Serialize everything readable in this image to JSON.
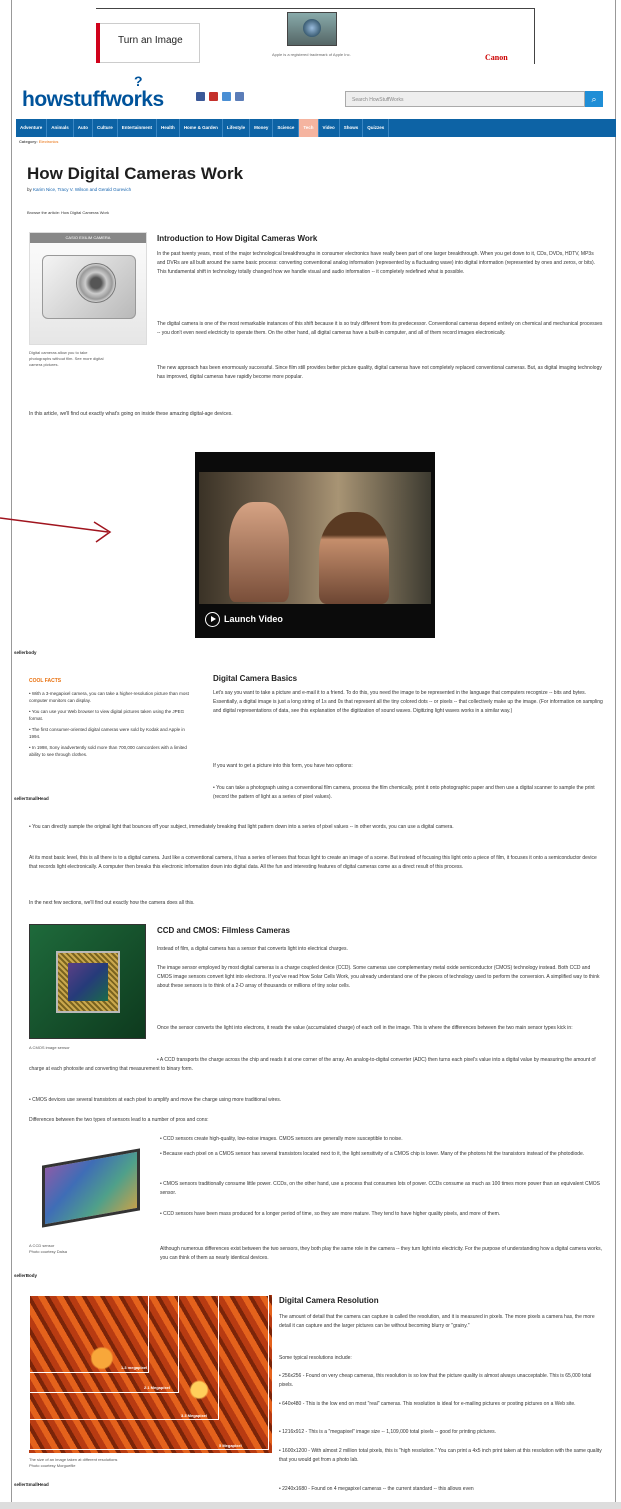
{
  "ad": {
    "headline": "Turn an Image",
    "fine_print": "Apple is a registered trademark of Apple Inc.",
    "brand": "Canon"
  },
  "header": {
    "logo": "howstuffworks",
    "search_placeholder": "Search HowStuffWorks"
  },
  "nav": {
    "items": [
      "Adventure",
      "Animals",
      "Auto",
      "Culture",
      "Entertainment",
      "Health",
      "Home & Garden",
      "Lifestyle",
      "Money",
      "Science",
      "Tech",
      "Video",
      "Shows",
      "Quizzes"
    ],
    "active_index": 10
  },
  "breadcrumb": {
    "prefix": "Category:",
    "current": "Electronics"
  },
  "article": {
    "title": "How Digital Cameras Work",
    "byline_prefix": "by",
    "authors": "Karim Nice, Tracy V. Wilson and Gerald Gurevich",
    "browse": "Browse the article: How Digital Cameras Work",
    "image_caption_top": "CASIO EXILIM CAMERA",
    "image_caption": "Digital cameras allow you to take photographs without film. See more digital camera pictures.",
    "intro_heading": "Introduction to How Digital Cameras Work",
    "intro_p1": "In the past twenty years, most of the major technological breakthroughs in consumer electronics have really been part of one larger breakthrough. When you get down to it, CDs, DVDs, HDTV, MP3s and DVRs are all built around the same basic process: converting conventional analog information (represented by a fluctuating wave) into digital information (represented by ones and zeros, or bits). This fundamental shift in technology totally changed how we handle visual and audio information -- it completely redefined what is possible.",
    "intro_p2": "The digital camera is one of the most remarkable instances of this shift because it is so truly different from its predecessor. Conventional cameras depend entirely on chemical and mechanical processes -- you don't even need electricity to operate them. On the other hand, all digital cameras have a built-in computer, and all of them record images electronically.",
    "intro_p3": "The new approach has been enormously successful. Since film still provides better picture quality, digital cameras have not completely replaced conventional cameras. But, as digital imaging technology has improved, digital cameras have rapidly become more popular.",
    "intro_p4": "In this article, we'll find out exactly what's going on inside these amazing digital-age devices.",
    "video_label": "Launch Video",
    "label_sellerbody1": "sellerbody",
    "facts_title": "COOL FACTS",
    "facts": [
      "With a 3-megapixel camera, you can take a higher-resolution picture than most computer monitors can display.",
      "You can use your Web browser to view digital pictures taken using the JPEG format.",
      "The first consumer-oriented digital cameras were sold by Kodak and Apple in 1994.",
      "In 1998, Sony inadvertently sold more than 700,000 camcorders with a limited ability to see through clothes."
    ],
    "label_sellersmall1": "sellerSmallHead",
    "basics_heading": "Digital Camera Basics",
    "basics_p1": "Let's say you want to take a picture and e-mail it to a friend. To do this, you need the image to be represented in the language that computers recognize -- bits and bytes. Essentially, a digital image is just a long string of 1s and 0s that represent all the tiny colored dots -- or pixels -- that collectively make up the image. (For information on sampling and digital representations of data, see this explanation of the digitization of sound waves. Digitizing light waves works in a similar way.)",
    "basics_p2": "If you want to get a picture into this form, you have two options:",
    "basics_opt1": "You can take a photograph using a conventional film camera, process the film chemically, print it onto photographic paper and then use a digital scanner to sample the print (record the pattern of light as a series of pixel values).",
    "basics_opt2": "You can directly sample the original light that bounces off your subject, immediately breaking that light pattern down into a series of pixel values -- in other words, you can use a digital camera.",
    "basics_p3": "At its most basic level, this is all there is to a digital camera. Just like a conventional camera, it has a series of lenses that focus light to create an image of a scene. But instead of focusing this light onto a piece of film, it focuses it onto a semiconductor device that records light electronically. A computer then breaks this electronic information down into digital data. All the fun and interesting features of digital cameras come as a direct result of this process.",
    "basics_p4": "In the next few sections, we'll find out exactly how the camera does all this.",
    "ccd_heading": "CCD and CMOS: Filmless Cameras",
    "ccd_p1": "Instead of film, a digital camera has a sensor that converts light into electrical charges.",
    "ccd_p2": "The image sensor employed by most digital cameras is a charge coupled device (CCD). Some cameras use complementary metal oxide semiconductor (CMOS) technology instead. Both CCD and CMOS image sensors convert light into electrons. If you've read How Solar Cells Work, you already understand one of the pieces of technology used to perform the conversion. A simplified way to think about these sensors is to think of a 2-D array of thousands or millions of tiny solar cells.",
    "ccd_p3": "Once the sensor converts the light into electrons, it reads the value (accumulated charge) of each cell in the image. This is where the differences between the two main sensor types kick in:",
    "ccd_b1": "A CCD transports the charge across the chip and reads it at one corner of the array. An analog-to-digital converter (ADC) then turns each pixel's value into a digital value by measuring the amount of charge at each photosite and converting that measurement to binary form.",
    "ccd_b2": "CMOS devices use several transistors at each pixel to amplify and move the charge using more traditional wires.",
    "chip_caption": "A CMOS image sensor",
    "diff_intro": "Differences between the two types of sensors lead to a number of pros and cons:",
    "diffs": [
      "CCD sensors create high-quality, low-noise images. CMOS sensors are generally more susceptible to noise.",
      "Because each pixel on a CMOS sensor has several transistors located next to it, the light sensitivity of a CMOS chip is lower. Many of the photons hit the transistors instead of the photodiode.",
      "CMOS sensors traditionally consume little power. CCDs, on the other hand, use a process that consumes lots of power. CCDs consume as much as 100 times more power than an equivalent CMOS sensor.",
      "CCD sensors have been mass produced for a longer period of time, so they are more mature. They tend to have higher quality pixels, and more of them."
    ],
    "diff_outro": "Although numerous differences exist between the two sensors, they both play the same role in the camera -- they turn light into electricity. For the purpose of understanding how a digital camera works, you can think of them as nearly identical devices.",
    "sensor_caption": "A CCD sensor\nPhoto courtesy Dalsa",
    "label_sellerbody2": "sellerBody",
    "res_heading": "Digital Camera Resolution",
    "res_p1": "The amount of detail that the camera can capture is called the resolution, and it is measured in pixels. The more pixels a camera has, the more detail it can capture and the larger pictures can be without becoming blurry or \"grainy.\"",
    "res_p2": "Some typical resolutions include:",
    "res_items": [
      "256x256 - Found on very cheap cameras, this resolution is so low that the picture quality is almost always unacceptable. This is 65,000 total pixels.",
      "640x480 - This is the low end on most \"real\" cameras. This resolution is ideal for e-mailing pictures or posting pictures on a Web site.",
      "1216x912 - This is a \"megapixel\" image size -- 1,109,000 total pixels -- good for printing pictures.",
      "1600x1200 - With almost 2 million total pixels, this is \"high resolution.\" You can print a 4x5 inch print taken at this resolution with the same quality that you would get from a photo lab.",
      "2240x1680 - Found on 4 megapixel cameras -- the current standard -- this allows even"
    ],
    "res_labels": [
      "1.3 megapixel",
      "2.1 Megapixel",
      "3.3 Megapixel",
      "5 Megapixel"
    ],
    "leaves_caption": "The size of an image taken at different resolutions\nPhoto courtesy Morguefile",
    "label_sellersmall2": "sellerSmallHead"
  }
}
